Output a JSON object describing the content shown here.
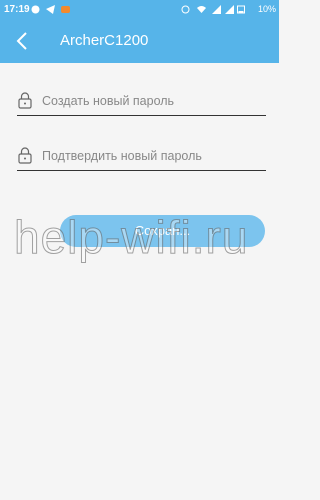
{
  "status_bar": {
    "time": "17:19",
    "battery": "10%"
  },
  "header": {
    "title": "ArcherC1200",
    "back_icon": "chevron-left-icon"
  },
  "form": {
    "new_password_placeholder": "Создать новый пароль",
    "confirm_password_placeholder": "Подтвердить новый пароль",
    "field_icon": "lock-icon",
    "save_label": "Сохран..."
  },
  "watermark": "help-wifi.ru",
  "colors": {
    "accent": "#56b4e9",
    "button": "#7cc4ee",
    "background": "#f5f5f5"
  }
}
